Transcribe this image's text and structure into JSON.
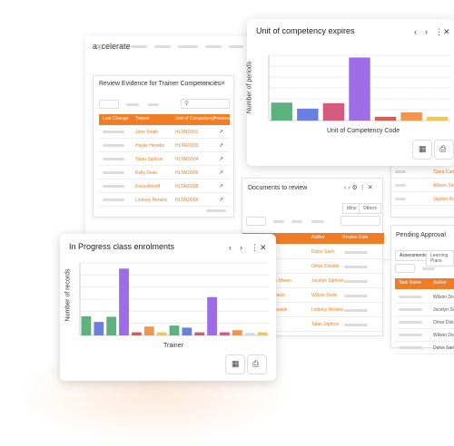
{
  "app": {
    "brand_prefix": "a",
    "brand_x": "x",
    "brand_suffix": "celerate"
  },
  "review_panel": {
    "title": "Review Evidence for Trainer Competencies",
    "columns": [
      "Last Change",
      "Trainer",
      "Unit of Competency",
      "Preview"
    ],
    "trainers": [
      "John Smith",
      "Haylie Herwitz",
      "Talan Siphron",
      "Kelly Dean",
      "Keira Amorff",
      "Lindsey Herwitz"
    ],
    "units": [
      "HLTAID001",
      "HLTAID003",
      "HLTAID004",
      "HLTAID006",
      "HLTAID008",
      "HLTAID009"
    ]
  },
  "documents_panel": {
    "title": "Documents to review",
    "tabs": [
      "Mine",
      "Others"
    ],
    "columns": [
      "Author",
      "Review Date"
    ],
    "author_partial": [
      "ick Sheen",
      "giness",
      "unsdale"
    ],
    "authors": [
      "Dulce Saris",
      "Omar Dokidis",
      "Jocelyn Siphron",
      "Wilson Dorin",
      "Lindsey Herwitz",
      "Talan Siphron"
    ]
  },
  "right_panel": {
    "names": [
      "Tiana Carter",
      "Allison Stanton",
      "Jaydon Rosser"
    ]
  },
  "pending_panel": {
    "title": "Pending Approval",
    "tabs": [
      "Assessments",
      "Learning Plans"
    ],
    "columns": [
      "Task Name",
      "Author"
    ],
    "authors": [
      "Wilson Dorin",
      "Jocelyn Siphron",
      "Omar Dokidis",
      "Wilson Dorin",
      "Dulce Saris"
    ]
  },
  "unit_chart": {
    "title": "Unit of competency expires",
    "icons": [
      "chevron-left-icon",
      "chevron-right-icon",
      "more-vertical-icon",
      "close-icon"
    ],
    "glyphs": {
      "prev": "‹",
      "next": "›",
      "more": "⋮",
      "close": "✕"
    }
  },
  "progress_chart": {
    "title": "In Progress class enrolments",
    "glyphs": {
      "prev": "‹",
      "next": "›",
      "more": "⋮",
      "close": "✕"
    }
  },
  "chart_data": [
    {
      "type": "bar",
      "title": "Unit of competency expires",
      "xlabel": "Unit of Competency Code",
      "ylabel": "Number of periods",
      "categories": [
        "",
        "",
        "",
        "",
        "",
        "",
        ""
      ],
      "values": [
        3.3,
        2.2,
        3.2,
        11.6,
        0.7,
        1.5,
        0.7
      ],
      "colors": [
        "#5db37e",
        "#6b7fe3",
        "#d55a7e",
        "#9f6ce8",
        "#e1584f",
        "#f0944f",
        "#f4c64f"
      ],
      "ylim": [
        0,
        12
      ],
      "grid": true
    },
    {
      "type": "bar",
      "title": "In Progress class enrolments",
      "xlabel": "Trainer",
      "ylabel": "Number of records",
      "categories": [
        "",
        "",
        "",
        "",
        "",
        "",
        "",
        "",
        "",
        "",
        "",
        "",
        "",
        "",
        ""
      ],
      "values": [
        3.7,
        2.6,
        3.6,
        12.9,
        0.6,
        1.7,
        0.6,
        1.9,
        1.5,
        0.6,
        7.4,
        0.6,
        1.0,
        0.5,
        0.6
      ],
      "colors": [
        "#5db37e",
        "#6b7fe3",
        "#5db37e",
        "#9f6ce8",
        "#e1584f",
        "#f0944f",
        "#f4c64f",
        "#5db37e",
        "#6b7fe3",
        "#d55a7e",
        "#9f6ce8",
        "#d55a7e",
        "#f0944f",
        "#d8d8d8",
        "#f4c64f"
      ],
      "ylim": [
        0,
        14
      ],
      "grid": true
    }
  ]
}
